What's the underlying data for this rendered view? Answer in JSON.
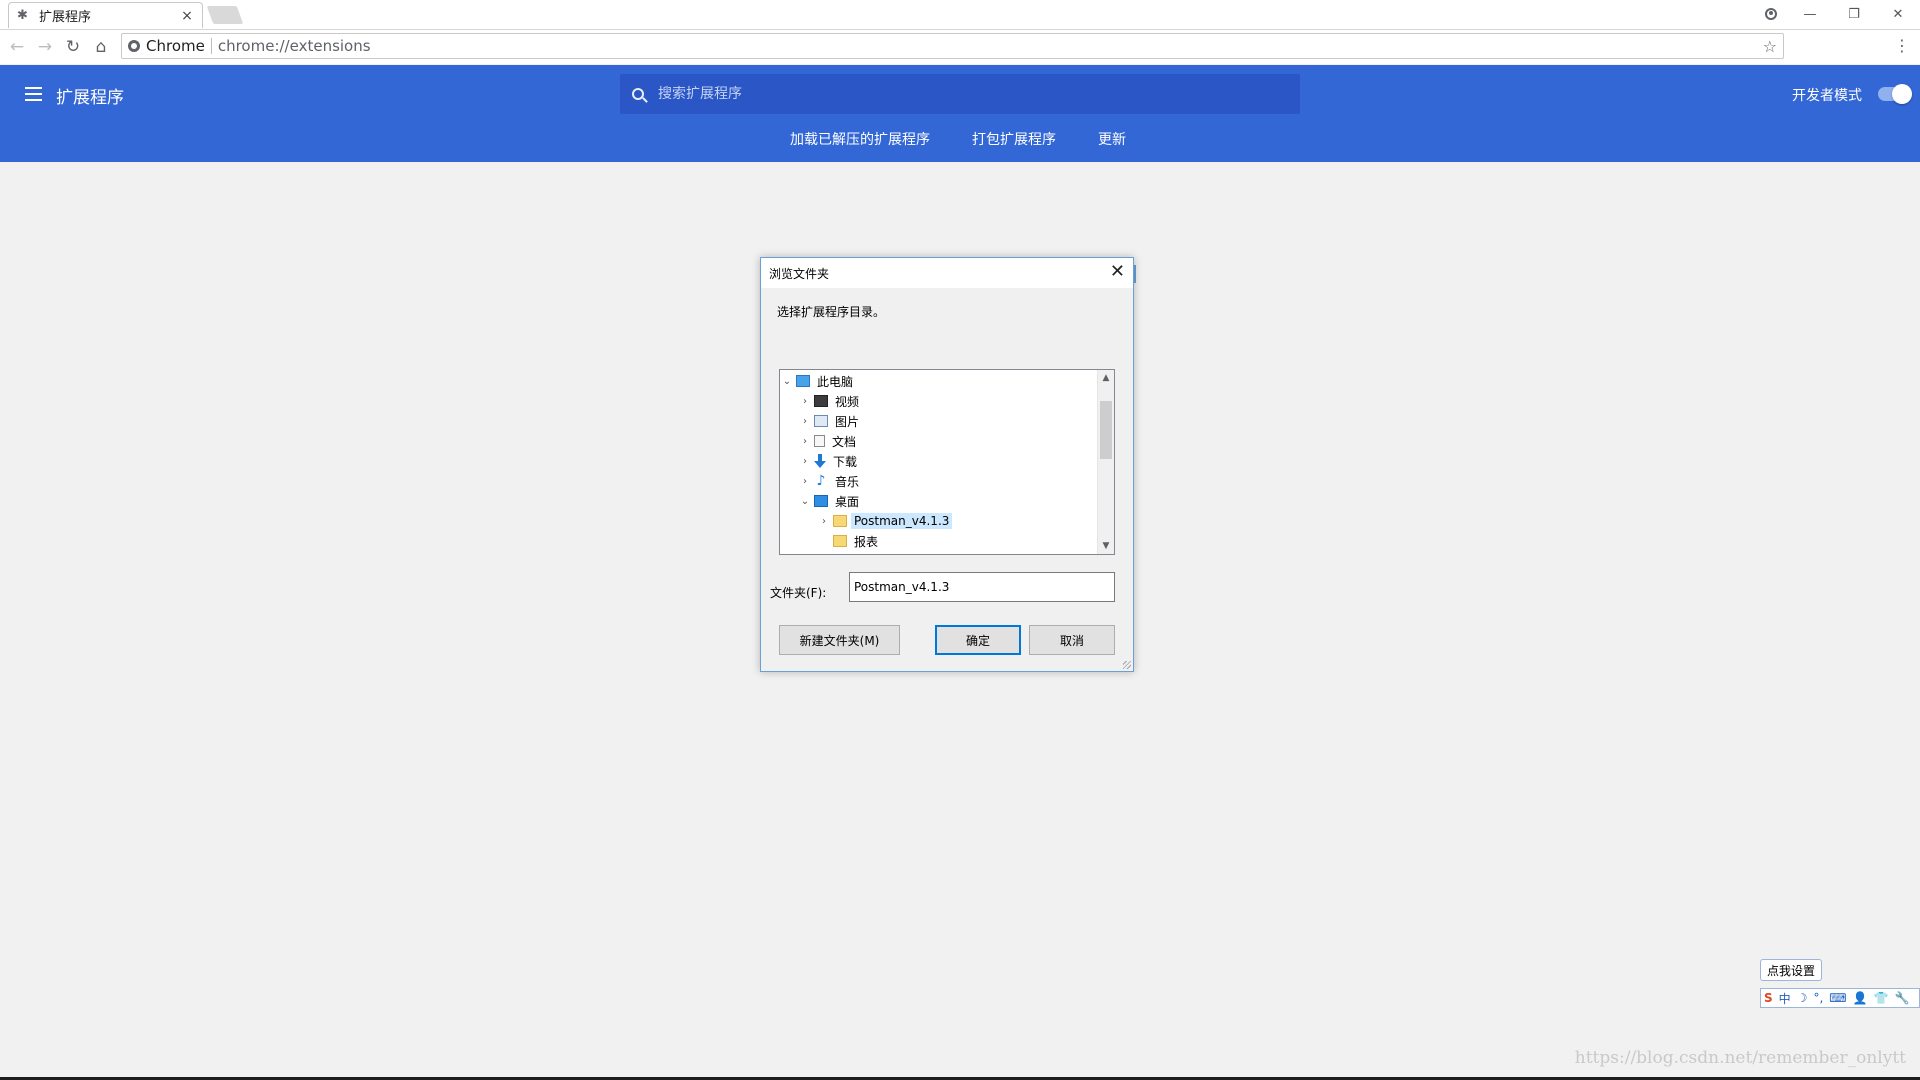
{
  "browser": {
    "tab_title": "扩展程序",
    "tab_close": "×",
    "omnibox_chip": "Chrome",
    "url": "chrome://extensions"
  },
  "icons": {
    "back": "←",
    "forward": "→",
    "reload": "↻",
    "home": "⌂",
    "star": "☆",
    "kebab": "⋮",
    "minimize": "—",
    "restore": "❐",
    "close": "✕",
    "extension_favicon": "✱"
  },
  "header": {
    "title": "扩展程序",
    "search_placeholder": "搜索扩展程序",
    "devmode_label": "开发者模式",
    "devmode_on": true,
    "actions": [
      "加载已解压的扩展程序",
      "打包扩展程序",
      "更新"
    ]
  },
  "dialog": {
    "title": "浏览文件夹",
    "prompt": "选择扩展程序目录。",
    "tree": [
      {
        "label": "此电脑",
        "chev": "⌄",
        "icon": "pc"
      },
      {
        "label": "视频",
        "chev": "›",
        "icon": "video"
      },
      {
        "label": "图片",
        "chev": "›",
        "icon": "pictures"
      },
      {
        "label": "文档",
        "chev": "›",
        "icon": "docs"
      },
      {
        "label": "下载",
        "chev": "›",
        "icon": "download"
      },
      {
        "label": "音乐",
        "chev": "›",
        "icon": "music"
      },
      {
        "label": "桌面",
        "chev": "⌄",
        "icon": "desktop"
      },
      {
        "label": "Postman_v4.1.3",
        "chev": "›",
        "icon": "folder",
        "selected": true
      },
      {
        "label": "报表",
        "chev": "",
        "icon": "folder"
      }
    ],
    "folder_label": "文件夹(F):",
    "folder_value": "Postman_v4.1.3",
    "new_folder_button": "新建文件夹(M)",
    "ok_button": "确定",
    "cancel_button": "取消"
  },
  "ime": {
    "tip": "点我设置",
    "logo": "S",
    "mode": "中",
    "icons": [
      "☽",
      "°,",
      "⌨",
      "👤",
      "👕",
      "🔧"
    ]
  },
  "watermark": "https://blog.csdn.net/remember_onlytt",
  "colors": {
    "header_blue": "#3367d6",
    "search_blue": "#2a56c6",
    "dialog_border": "#6a9fd8",
    "selection": "#cce8ff",
    "primary_button_border": "#0078d7"
  }
}
